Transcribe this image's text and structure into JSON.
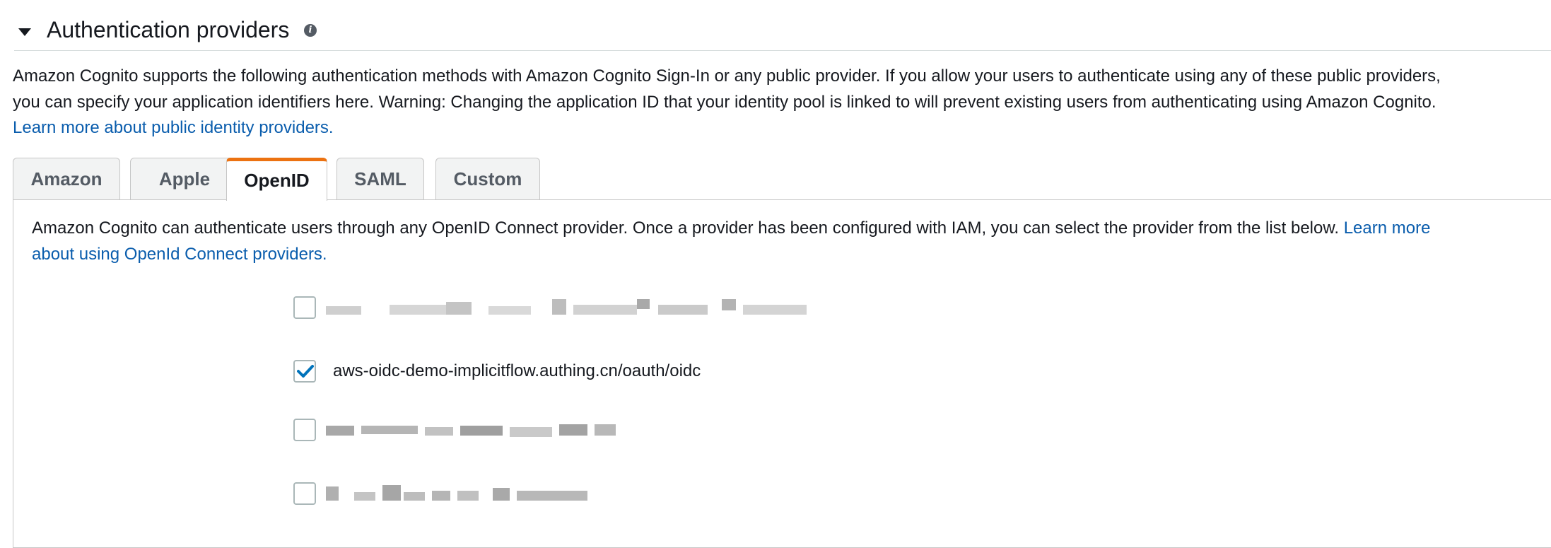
{
  "section": {
    "title": "Authentication providers",
    "info_icon": "info-icon"
  },
  "intro": {
    "line1": "Amazon Cognito supports the following authentication methods with Amazon Cognito Sign-In or any public provider. If you allow your users to authenticate using any of these public providers,",
    "line2": "you can specify your application identifiers here. Warning: Changing the application ID that your identity pool is linked to will prevent existing users from authenticating using Amazon Cognito.",
    "link": "Learn more about public identity providers."
  },
  "tabs": [
    {
      "label": "Amazon",
      "active": false
    },
    {
      "label": "Apple",
      "active": false
    },
    {
      "label": "OpenID",
      "active": true
    },
    {
      "label": "SAML",
      "active": false
    },
    {
      "label": "Custom",
      "active": false
    }
  ],
  "panel": {
    "desc": "Amazon Cognito can authenticate users through any OpenID Connect provider. Once a provider has been configured with IAM, you can select the provider from the list below.",
    "link_part1": "Learn more",
    "link_part2": "about using OpenId Connect providers."
  },
  "providers": [
    {
      "label": "",
      "checked": false,
      "redacted": true
    },
    {
      "label": "aws-oidc-demo-implicitflow.authing.cn/oauth/oidc",
      "checked": true,
      "redacted": false
    },
    {
      "label": "",
      "checked": false,
      "redacted": true
    },
    {
      "label": "",
      "checked": false,
      "redacted": true
    }
  ],
  "colors": {
    "accent_tab": "#ec7211",
    "link": "#0a5dad",
    "checkbox_checked": "#0073bb"
  }
}
